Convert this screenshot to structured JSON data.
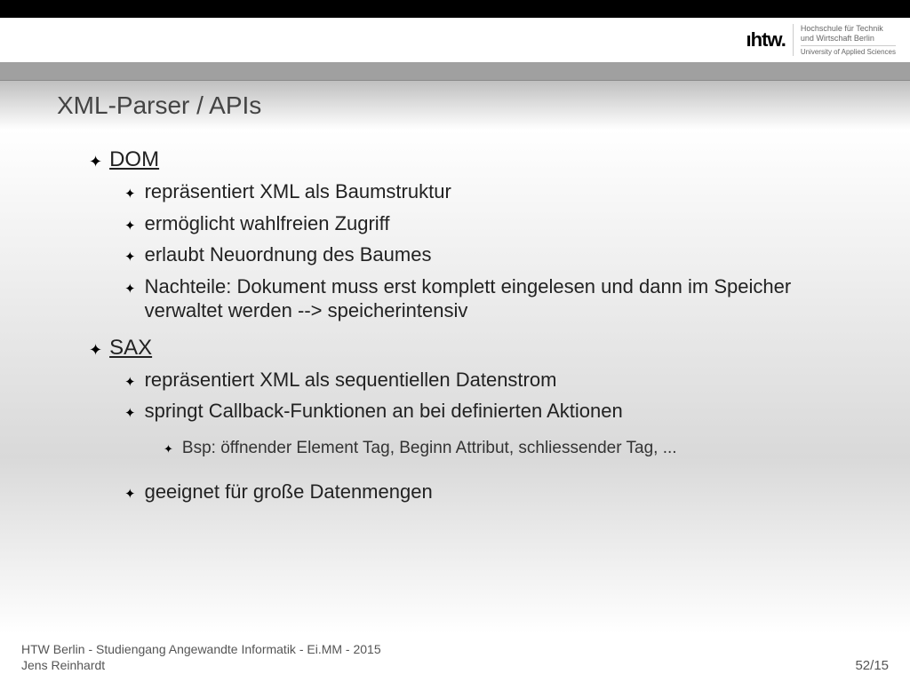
{
  "header": {
    "logo_lines": [
      "Hochschule für Technik",
      "und Wirtschaft Berlin",
      "University of Applied Sciences"
    ]
  },
  "title": "XML-Parser / APIs",
  "sections": [
    {
      "heading": "DOM",
      "items": [
        "repräsentiert XML als Baumstruktur",
        "ermöglicht wahlfreien Zugriff",
        "erlaubt Neuordnung des Baumes",
        "Nachteile: Dokument muss erst komplett eingelesen und dann im Speicher verwaltet werden --> speicherintensiv"
      ]
    },
    {
      "heading": "SAX",
      "items": [
        "repräsentiert XML als sequentiellen Datenstrom",
        "springt Callback-Funktionen an bei definierten Aktionen",
        "geeignet für große Datenmengen"
      ],
      "subitems": [
        "Bsp: öffnender Element Tag, Beginn Attribut, schliessender Tag, ..."
      ]
    }
  ],
  "footer": {
    "line1": "HTW Berlin - Studiengang Angewandte Informatik - Ei.MM - 2015",
    "line2": "Jens Reinhardt",
    "page": "52",
    "page_sep": "/",
    "total": "15"
  }
}
